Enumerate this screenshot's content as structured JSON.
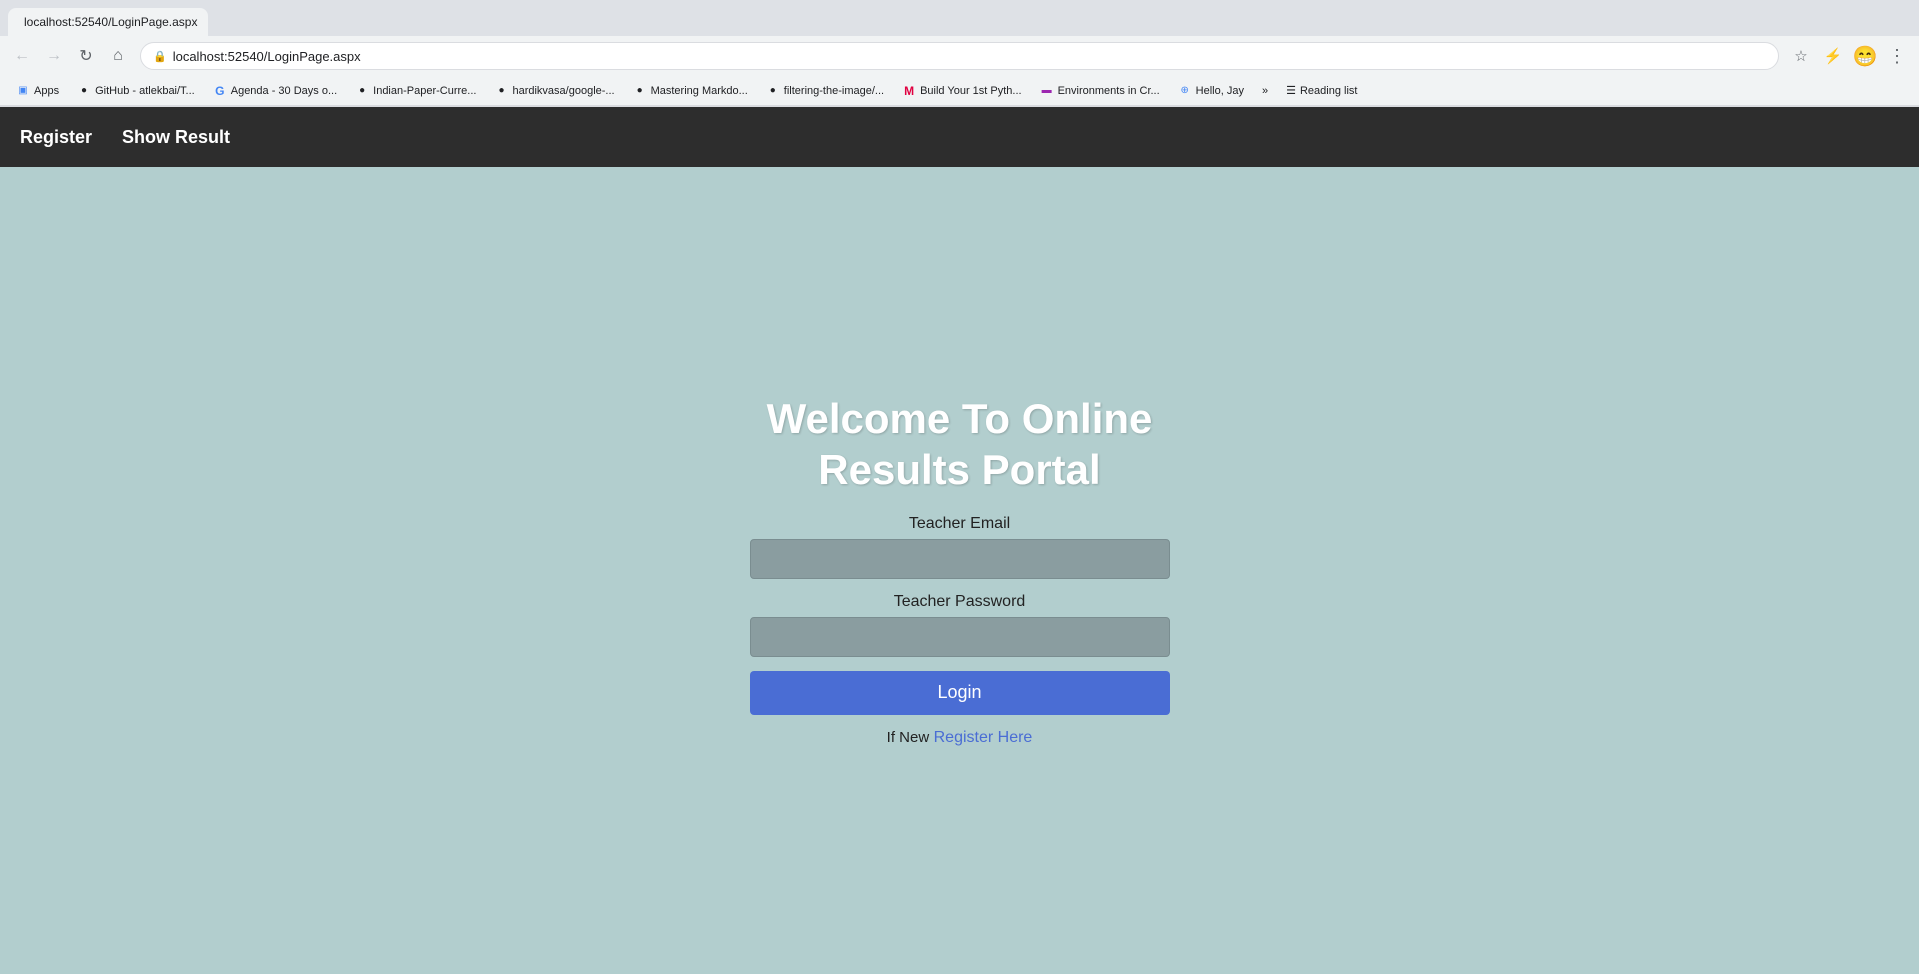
{
  "browser": {
    "tab_title": "localhost:52540/LoginPage.aspx",
    "address": "localhost:52540/LoginPage.aspx",
    "bookmarks": [
      {
        "label": "Apps",
        "icon": "⊞",
        "color": "#4285f4"
      },
      {
        "label": "GitHub - atlekbai/T...",
        "icon": "⬤",
        "color": "#333"
      },
      {
        "label": "Agenda - 30 Days o...",
        "icon": "G",
        "color": "#4285f4"
      },
      {
        "label": "Indian-Paper-Curre...",
        "icon": "⬤",
        "color": "#333"
      },
      {
        "label": "hardikvasa/google-...",
        "icon": "⬤",
        "color": "#333"
      },
      {
        "label": "Mastering Markdo...",
        "icon": "⬤",
        "color": "#333"
      },
      {
        "label": "filtering-the-image/...",
        "icon": "⬤",
        "color": "#333"
      },
      {
        "label": "Build Your 1st Pyth...",
        "icon": "M",
        "color": "#e04"
      },
      {
        "label": "Environments in Cr...",
        "icon": "▬",
        "color": "#9c27b0"
      },
      {
        "label": "Hello, Jay",
        "icon": "⊕",
        "color": "#4285f4"
      },
      {
        "label": "»",
        "icon": "",
        "color": "#333"
      },
      {
        "label": "Reading list",
        "icon": "≡",
        "color": "#333"
      }
    ]
  },
  "navbar": {
    "register_label": "Register",
    "show_result_label": "Show Result"
  },
  "login_form": {
    "welcome_line1": "Welcome To Online",
    "welcome_line2": "Results Portal",
    "email_label": "Teacher Email",
    "email_placeholder": "",
    "password_label": "Teacher Password",
    "password_placeholder": "",
    "login_button": "Login",
    "if_new_text": "If New",
    "register_here_link": "Register Here"
  }
}
